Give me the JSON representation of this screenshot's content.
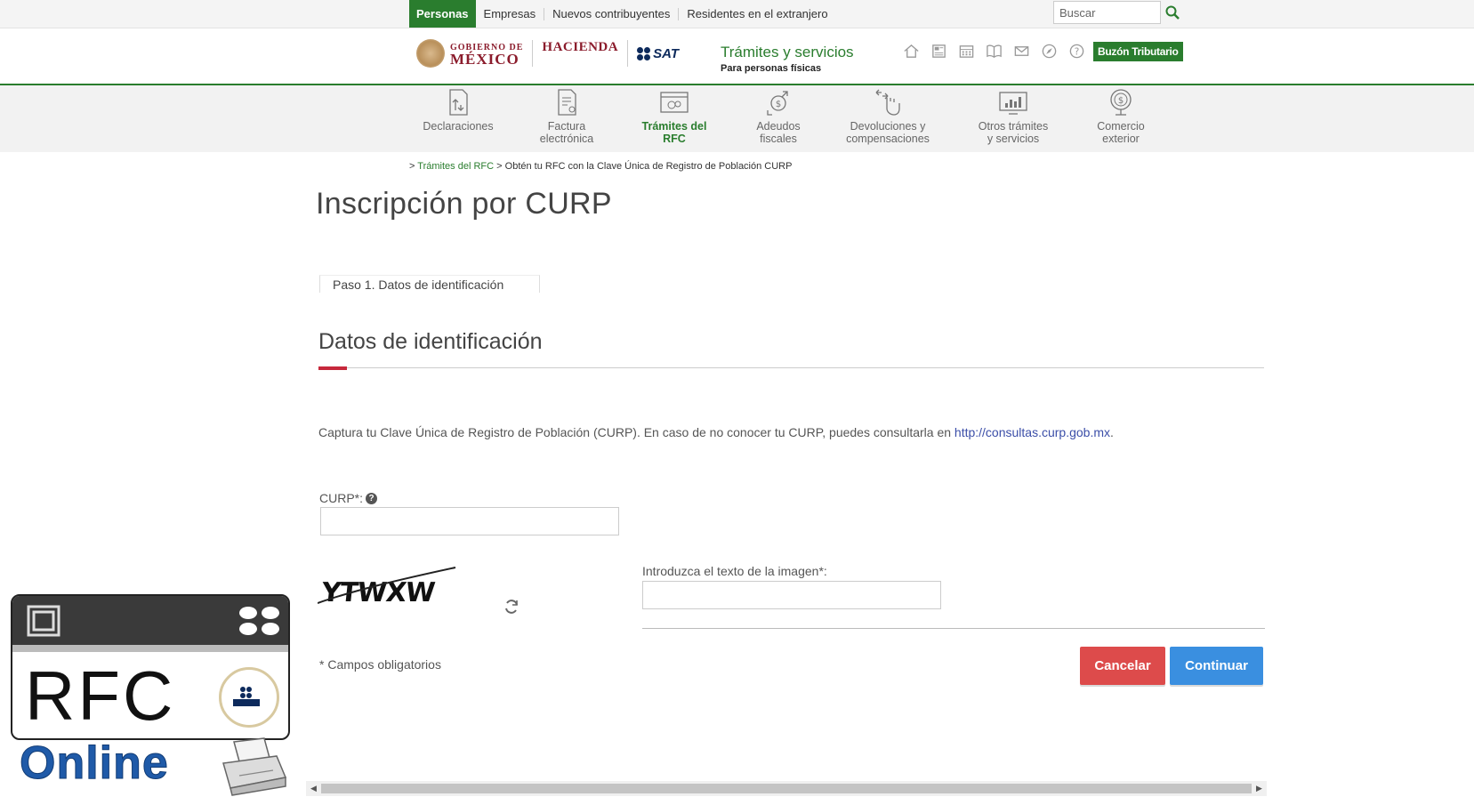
{
  "topnav": {
    "items": [
      "Personas",
      "Empresas",
      "Nuevos contribuyentes",
      "Residentes en el extranjero"
    ],
    "active": "Personas"
  },
  "search": {
    "placeholder": "Buscar"
  },
  "header": {
    "gob_line1": "GOBIERNO DE",
    "gob_line2": "MÉXICO",
    "hacienda": "HACIENDA",
    "sat": "SAT",
    "title": "Trámites y servicios",
    "subtitle": "Para personas físicas",
    "icons": [
      "home-icon",
      "newspaper-icon",
      "calendar-icon",
      "book-icon",
      "mail-icon",
      "compass-icon",
      "help-circle-icon"
    ],
    "buzon_label": "Buzón Tributario"
  },
  "mainnav": [
    {
      "line1": "Declaraciones",
      "line2": "",
      "icon": "declaraciones-icon"
    },
    {
      "line1": "Factura",
      "line2": "electrónica",
      "icon": "factura-icon"
    },
    {
      "line1": "Trámites del",
      "line2": "RFC",
      "icon": "tramites-rfc-icon",
      "active": true
    },
    {
      "line1": "Adeudos",
      "line2": "fiscales",
      "icon": "adeudos-icon"
    },
    {
      "line1": "Devoluciones y",
      "line2": "compensaciones",
      "icon": "devoluciones-icon"
    },
    {
      "line1": "Otros trámites",
      "line2": "y servicios",
      "icon": "otros-tramites-icon"
    },
    {
      "line1": "Comercio",
      "line2": "exterior",
      "icon": "comercio-exterior-icon"
    }
  ],
  "breadcrumb": {
    "sep": ">",
    "link": "Trámites del RFC",
    "current": "Obtén tu RFC con la Clave Única de Registro de Población CURP"
  },
  "page_title": "Inscripción por CURP",
  "step_tab": "Paso 1. Datos de identificación",
  "section_title": "Datos de identificación",
  "instructions": {
    "text": "Captura tu Clave Única de Registro de Población (CURP). En caso de no conocer tu CURP, puedes consultarla en ",
    "link": "http://consultas.curp.gob.mx",
    "after": "."
  },
  "form": {
    "curp_label": "CURP*:",
    "curp_value": "",
    "captcha_text": "YTWXW",
    "captcha_label": "Introduzca el texto de la imagen*:",
    "captcha_value": "",
    "required_note": "* Campos obligatorios",
    "cancel_label": "Cancelar",
    "continue_label": "Continuar"
  },
  "watermark": {
    "rfc": "RFC",
    "online": "Online"
  },
  "colors": {
    "brand_green": "#2a7d2e",
    "gob_maroon": "#8b1c2c",
    "accent_red": "#c6283b",
    "cancel_red": "#dd4b4b",
    "continue_blue": "#3a8fe0",
    "link_blue": "#3b4ea8"
  }
}
